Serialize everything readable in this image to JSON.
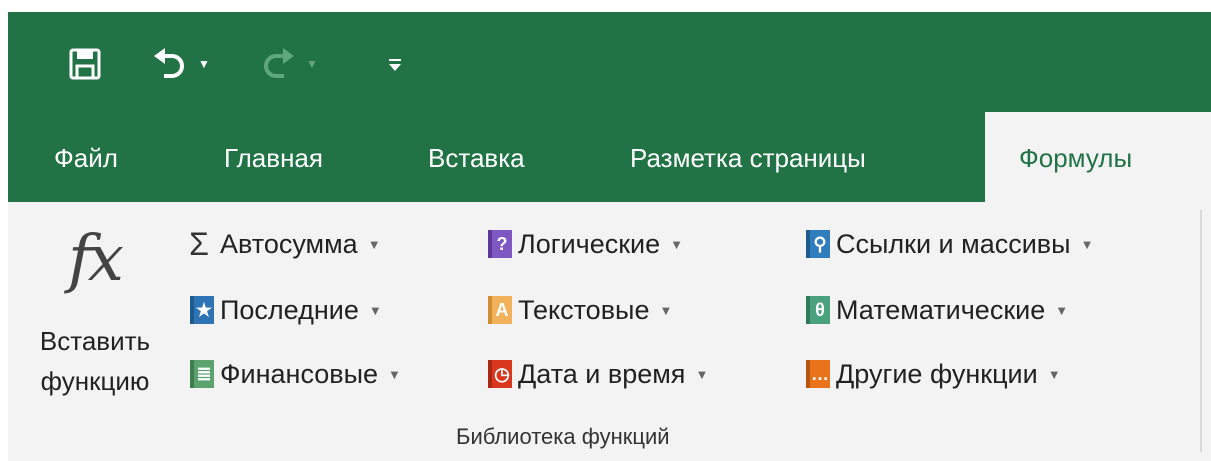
{
  "tabs": [
    "Файл",
    "Главная",
    "Вставка",
    "Разметка страницы",
    "Формулы"
  ],
  "active_tab": "Формулы",
  "quick_access": {
    "save_icon": "save-icon",
    "undo_icon": "undo-icon",
    "redo_icon": "redo-icon",
    "customize_icon": "customize-qat-icon"
  },
  "insert_function": {
    "glyph": "fx",
    "line1": "Вставить",
    "line2": "функцию"
  },
  "commands": [
    {
      "label": "Автосумма",
      "icon": "sigma-icon"
    },
    {
      "label": "Последние",
      "icon": "star-book-icon",
      "color": "#2e74b5"
    },
    {
      "label": "Финансовые",
      "icon": "finance-book-icon",
      "color": "#5ba26f"
    },
    {
      "label": "Логические",
      "icon": "question-book-icon",
      "color": "#7e57c2"
    },
    {
      "label": "Текстовые",
      "icon": "text-book-icon",
      "color": "#f2b25c"
    },
    {
      "label": "Дата и время",
      "icon": "clock-book-icon",
      "color": "#d9381e"
    },
    {
      "label": "Ссылки и массивы",
      "icon": "lookup-book-icon",
      "color": "#2f7dbd"
    },
    {
      "label": "Математические",
      "icon": "theta-book-icon",
      "color": "#4aa17e"
    },
    {
      "label": "Другие функции",
      "icon": "more-book-icon",
      "color": "#e8731a"
    }
  ],
  "group_label": "Библиотека функций",
  "colors": {
    "excel_green": "#217346",
    "ribbon_bg": "#f3f3f3"
  }
}
